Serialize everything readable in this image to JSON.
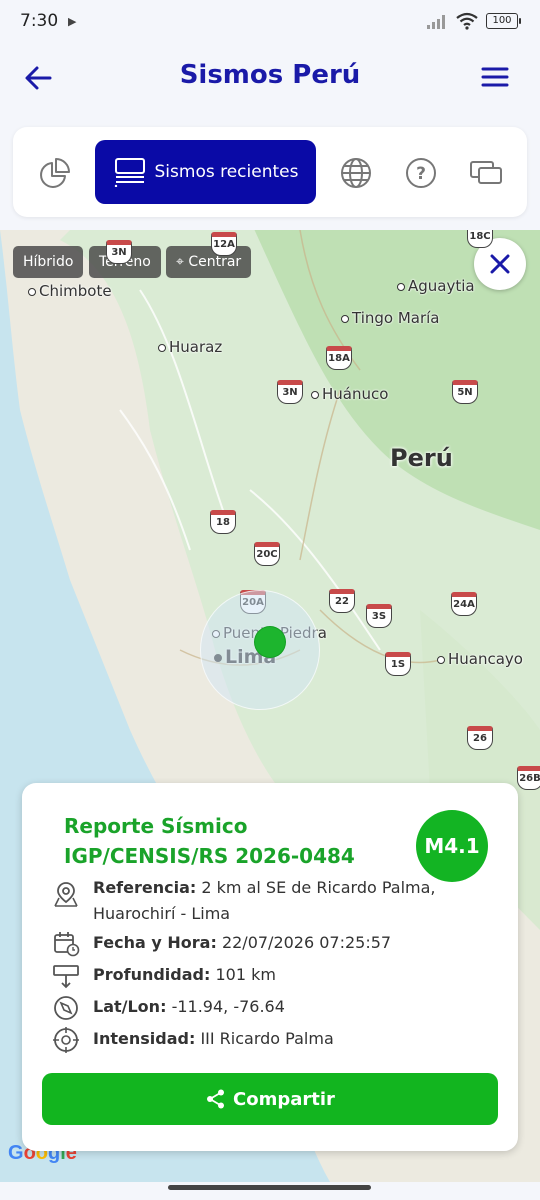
{
  "status_bar": {
    "time": "7:30",
    "battery": "100"
  },
  "app_bar": {
    "title": "Sismos Perú"
  },
  "tabs": {
    "active_label": "Sismos recientes"
  },
  "map": {
    "buttons": {
      "hybrid": "Híbrido",
      "terrain": "Terreno",
      "center": "Centrar"
    },
    "places": {
      "chimbote": "Chimbote",
      "aguaytia": "Aguaytia",
      "tingo_maria": "Tingo María",
      "huaraz": "Huaraz",
      "huanuco": "Huánuco",
      "puente_piedra": "Puente Piedra",
      "lima": "Lima",
      "huancayo": "Huancayo"
    },
    "country": "Perú",
    "shields": [
      "3N",
      "12A",
      "18C",
      "18A",
      "3N",
      "5N",
      "18",
      "20C",
      "20A",
      "22",
      "3S",
      "24A",
      "1S",
      "26",
      "26B"
    ],
    "google": "Google"
  },
  "report": {
    "title_line1": "Reporte Sísmico",
    "title_line2": "IGP/CENSIS/RS 2026-0484",
    "magnitude": "M4.1",
    "reference_label": "Referencia:",
    "reference_value": "2 km al SE de Ricardo Palma,",
    "reference_value2": "Huarochirí - Lima",
    "datetime_label": "Fecha y Hora:",
    "datetime_value": "22/07/2026 07:25:57",
    "depth_label": "Profundidad:",
    "depth_value": "101 km",
    "latlon_label": "Lat/Lon:",
    "latlon_value": "-11.94, -76.64",
    "intensity_label": "Intensidad:",
    "intensity_value": "III Ricardo Palma",
    "share_label": "Compartir"
  },
  "colors": {
    "brand_blue": "#0a0aa6",
    "accent_green": "#13b423"
  }
}
